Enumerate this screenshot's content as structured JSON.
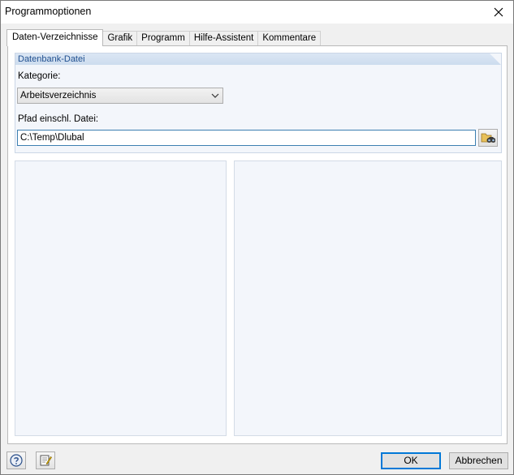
{
  "window": {
    "title": "Programmoptionen"
  },
  "tabs": [
    {
      "label": "Daten-Verzeichnisse",
      "active": true
    },
    {
      "label": "Grafik",
      "active": false
    },
    {
      "label": "Programm",
      "active": false
    },
    {
      "label": "Hilfe-Assistent",
      "active": false
    },
    {
      "label": "Kommentare",
      "active": false
    }
  ],
  "group": {
    "title": "Datenbank-Datei",
    "category_label": "Kategorie:",
    "category_value": "Arbeitsverzeichnis",
    "path_label": "Pfad einschl. Datei:",
    "path_value": "C:\\Temp\\Dlubal"
  },
  "footer": {
    "ok_label": "OK",
    "cancel_label": "Abbrechen"
  },
  "colors": {
    "accent": "#0078d7",
    "group_title": "#1f4f8f"
  }
}
